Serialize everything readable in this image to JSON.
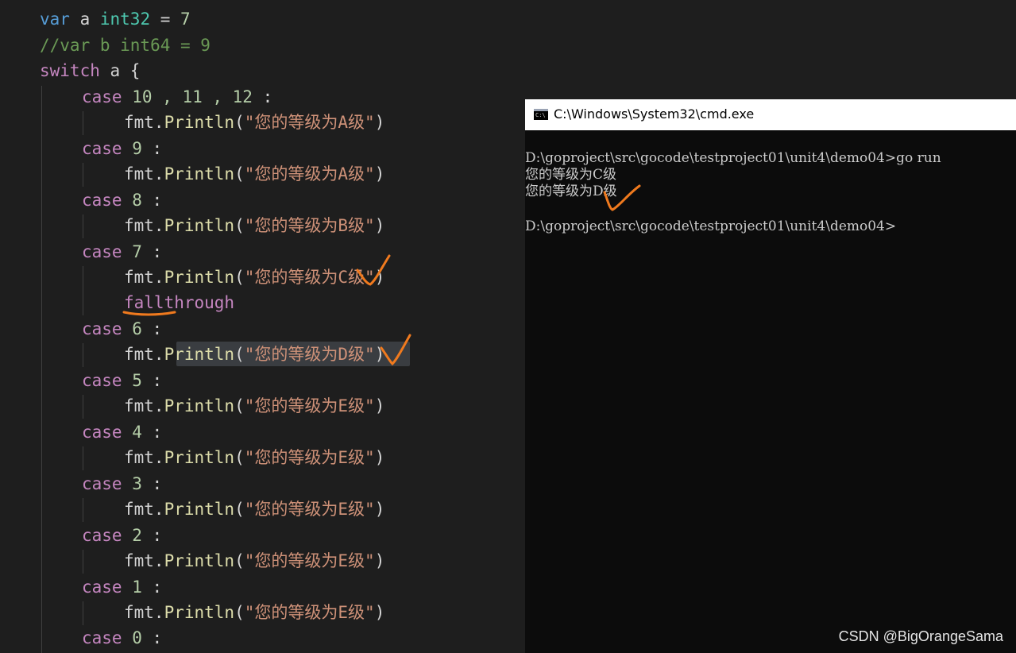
{
  "editor": {
    "line1": {
      "kw": "var",
      "ident": " a ",
      "type": "int32",
      "rest": " = ",
      "num": "7"
    },
    "line2": "//var b int64 = 9",
    "line3": {
      "kw": "switch",
      "rest": " a {"
    },
    "case_kw": "case",
    "case_values": [
      "10 , 11 , 12",
      "9",
      "8",
      "7",
      "6",
      "5",
      "4",
      "3",
      "2",
      "1",
      "0"
    ],
    "colon": " :",
    "call_obj": "fmt.",
    "call_fn": "Println",
    "open_paren": "(",
    "close_paren": ")",
    "strings": [
      "\"您的等级为A级\"",
      "\"您的等级为A级\"",
      "\"您的等级为B级\"",
      "\"您的等级为C级\"",
      "\"您的等级为D级\"",
      "\"您的等级为E级\"",
      "\"您的等级为E级\"",
      "\"您的等级为E级\"",
      "\"您的等级为E级\"",
      "\"您的等级为E级\""
    ],
    "fallthrough": "fallthrough"
  },
  "cmd": {
    "title": "C:\\Windows\\System32\\cmd.exe",
    "icon_text": "C:\\",
    "lines": [
      "D:\\goproject\\src\\gocode\\testproject01\\unit4\\demo04>go run",
      "您的等级为C级",
      "您的等级为D级",
      "",
      "D:\\goproject\\src\\gocode\\testproject01\\unit4\\demo04>"
    ]
  },
  "watermark": "CSDN @BigOrangeSama",
  "colors": {
    "editor_bg": "#1e1e1e",
    "cmd_bg": "#0c0c0c",
    "annotation": "#f07a1e"
  }
}
